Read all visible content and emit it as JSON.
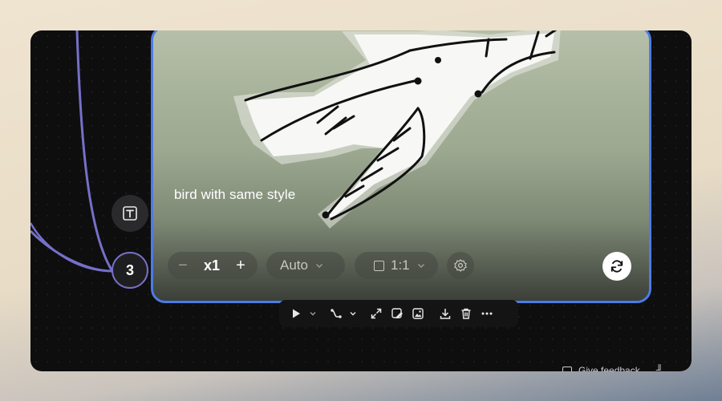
{
  "node": {
    "prompt_text": "bird with same style",
    "quantity": {
      "minus": "−",
      "value": "x1",
      "plus": "+"
    },
    "mode": {
      "label": "Auto"
    },
    "aspect_ratio": {
      "label": "1:1"
    },
    "icons": {
      "settings": "gear-icon",
      "refresh": "refresh-icon",
      "chevron": "chevron-down-icon"
    }
  },
  "side": {
    "text_node_icon": "text-icon",
    "connection_count": "3"
  },
  "toolbar": {
    "items": [
      "play-icon",
      "chevron-down-icon",
      "connector-icon",
      "chevron-down-icon",
      "expand-icon",
      "edit-image-icon",
      "image-frame-icon",
      "download-icon",
      "trash-icon",
      "more-icon"
    ]
  },
  "footer": {
    "feedback_label": "Give feedback",
    "extra_label": "╜"
  },
  "colors": {
    "accent": "#4c7be6",
    "wire": "#7670c8",
    "canvas": "#0e0e0f"
  }
}
